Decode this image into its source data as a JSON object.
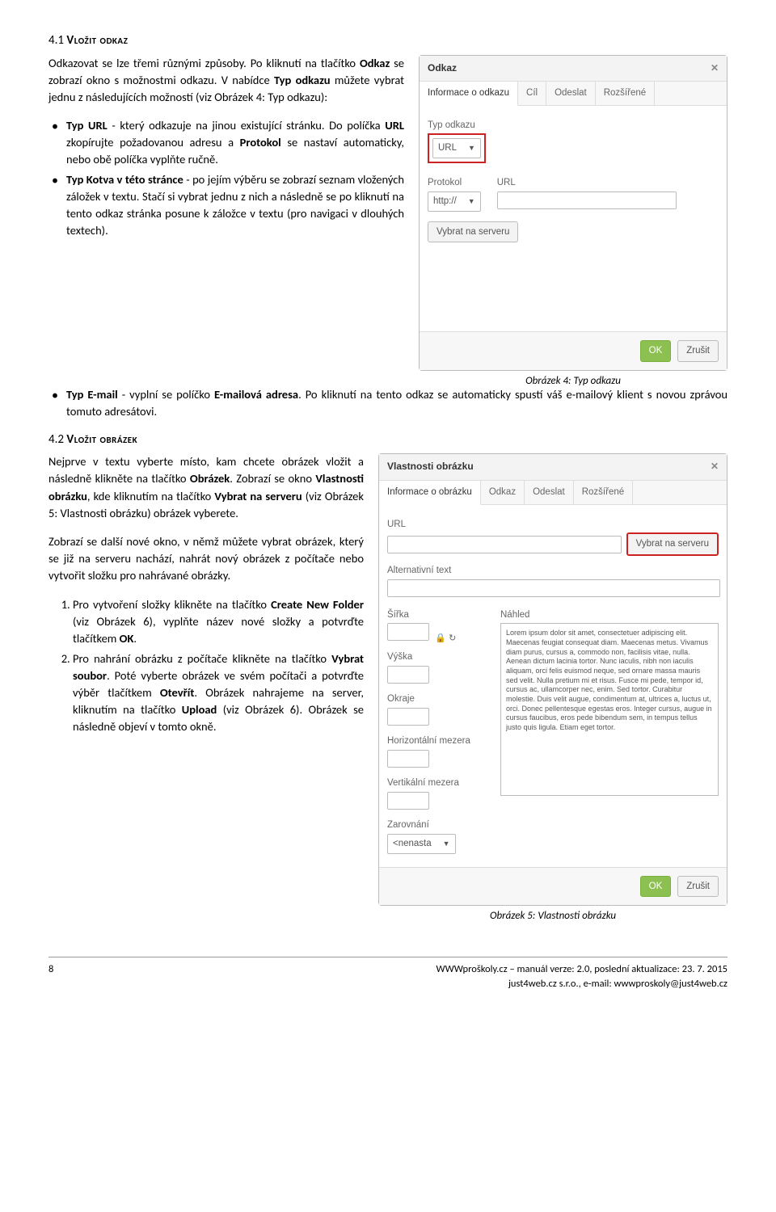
{
  "section1": {
    "num": "4.1",
    "title": "Vložit odkaz",
    "p1a": "Odkazovat se lze třemi různými způsoby. Po kliknutí na tlačítko ",
    "p1b": "Odkaz",
    "p1c": " se zobrazí okno s možnostmi odkazu. V nabídce ",
    "p1d": "Typ odkazu",
    "p1e": " můžete vybrat jednu z následujících možností (viz Obrázek 4: Typ odkazu):",
    "bullets": [
      {
        "b1": "Typ URL",
        "t1": " - který odkazuje na jinou existující stránku. Do políčka ",
        "b2": "URL",
        "t2": " zkopírujte požadovanou adresu a ",
        "b3": "Protokol",
        "t3": " se nastaví automaticky, nebo obě políčka vyplňte ručně."
      },
      {
        "b1": "Typ Kotva v této stránce",
        "t1": " - po jejím výběru se zobrazí seznam vložených záložek v textu. Stačí si vybrat jednu z nich a následně se po kliknutí na tento odkaz stránka posune k záložce v textu (pro navigaci v dlouhých textech)."
      },
      {
        "b1": "Typ E-mail",
        "t1": " - vyplní se políčko ",
        "b2": "E-mailová adresa",
        "t2": ". Po kliknutí na tento odkaz se automaticky spustí váš e-mailový klient s novou zprávou tomuto adresátovi."
      }
    ],
    "caption": "Obrázek 4: Typ odkazu"
  },
  "dialog1": {
    "title": "Odkaz",
    "tabs": [
      "Informace o odkazu",
      "Cíl",
      "Odeslat",
      "Rozšířené"
    ],
    "type_label": "Typ odkazu",
    "type_value": "URL",
    "protokol_label": "Protokol",
    "protokol_value": "http://",
    "url_label": "URL",
    "server_btn": "Vybrat na serveru",
    "ok": "OK",
    "cancel": "Zrušit"
  },
  "section2": {
    "num": "4.2",
    "title": "Vložit obrázek",
    "p1a": "Nejprve v textu vyberte místo, kam chcete obrázek vložit a následně klikněte na tlačítko ",
    "p1b": "Obrázek",
    "p1c": ". Zobrazí se okno ",
    "p1d": "Vlastnosti obrázku",
    "p1e": ", kde kliknutím na tlačítko ",
    "p1f": "Vybrat na serveru",
    "p1g": " (viz Obrázek 5: Vlastnosti obrázku) obrázek vyberete.",
    "p2": "Zobrazí se další nové okno, v němž můžete vybrat obrázek, který se již na serveru nachází, nahrát nový obrázek z počítače nebo vytvořit složku pro nahrávané obrázky.",
    "ol": [
      {
        "t1": "Pro vytvoření složky klikněte na tlačítko ",
        "b1": "Create New Folder",
        "t2": " (viz Obrázek 6), vyplňte název nové složky a potvrďte tlačítkem ",
        "b2": "OK",
        "t3": "."
      },
      {
        "t1": "Pro nahrání obrázku z počítače klikněte na tlačítko ",
        "b1": "Vybrat soubor",
        "t2": ". Poté vyberte obrázek ve svém počítači a potvrďte výběr tlačítkem ",
        "b2": "Otevřít",
        "t3": ". Obrázek nahrajeme na server, kliknutím na tlačítko ",
        "b3": "Upload",
        "t4": " (viz Obrázek 6). Obrázek se následně objeví v tomto okně."
      }
    ],
    "caption": "Obrázek 5: Vlastnosti obrázku"
  },
  "dialog2": {
    "title": "Vlastnosti obrázku",
    "tabs": [
      "Informace o obrázku",
      "Odkaz",
      "Odeslat",
      "Rozšířené"
    ],
    "url_label": "URL",
    "server_btn": "Vybrat na serveru",
    "alt_label": "Alternativní text",
    "sirka": "Šířka",
    "vyska": "Výška",
    "okraje": "Okraje",
    "hmezera": "Horizontální mezera",
    "vmezera": "Vertikální mezera",
    "zarovnani": "Zarovnání",
    "zarovnani_val": "<nenasta",
    "nahled": "Náhled",
    "lorem": "Lorem ipsum dolor sit amet, consectetuer adipiscing elit. Maecenas feugiat consequat diam. Maecenas metus. Vivamus diam purus, cursus a, commodo non, facilisis vitae, nulla. Aenean dictum lacinia tortor. Nunc iaculis, nibh non iaculis aliquam, orci felis euismod neque, sed ornare massa mauris sed velit. Nulla pretium mi et risus. Fusce mi pede, tempor id, cursus ac, ullamcorper nec, enim. Sed tortor. Curabitur molestie. Duis velit augue, condimentum at, ultrices a, luctus ut, orci. Donec pellentesque egestas eros. Integer cursus, augue in cursus faucibus, eros pede bibendum sem, in tempus tellus justo quis ligula. Etiam eget tortor.",
    "ok": "OK",
    "cancel": "Zrušit"
  },
  "footer": {
    "page": "8",
    "line1": "WWWproškoly.cz – manuál verze: 2.0, poslední aktualizace: 23. 7. 2015",
    "line2": "just4web.cz s.r.o., e-mail: wwwproskoly@just4web.cz"
  }
}
